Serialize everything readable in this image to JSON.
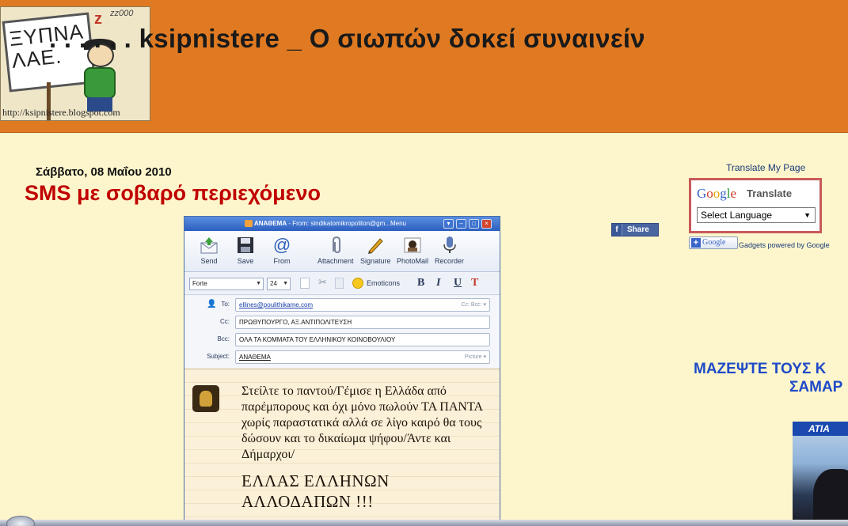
{
  "header": {
    "title": ". . . . . . ksipnistere _ Ο σιωπών δοκεί συναινείν",
    "logo": {
      "sign_text_line1": "ΞΥΠΝΑ",
      "sign_text_line2": "ΛΑΕ.",
      "z_mark": "z",
      "zz_mark": "zz000",
      "url": "http://ksipnistere.blogspot.com"
    }
  },
  "post": {
    "date": "Σάββατο, 08 Μαΐου 2010",
    "title": "SMS με σοβαρό περιεχόμενο",
    "email_window": {
      "titlebar_prefix": "ΑΝΑΘΕΜΑ",
      "titlebar_from": " - From: sindikatomikropoliton@gm...",
      "titlebar_menu": "Menu",
      "toolbar": [
        {
          "label": "Send",
          "icon": "send-envelope-icon"
        },
        {
          "label": "Save",
          "icon": "floppy-disk-icon"
        },
        {
          "label": "From",
          "icon": "at-sign-icon"
        },
        {
          "label": "Attachment",
          "icon": "paperclip-icon"
        },
        {
          "label": "Signature",
          "icon": "pen-icon"
        },
        {
          "label": "PhotoMail",
          "icon": "photo-icon"
        },
        {
          "label": "Recorder",
          "icon": "microphone-icon"
        }
      ],
      "format": {
        "font": "Forte",
        "size": "24",
        "emoticons_label": "Emoticons",
        "bold": "B",
        "italic": "I",
        "underline": "U",
        "text_color": "T"
      },
      "fields": {
        "to_label": "To:",
        "to_value": "ellines@poulithikame.com",
        "to_hint": "Cc: Bcc: ▾",
        "cc_label": "Cc:",
        "cc_value": "ΠΡΩΘΥΠΟΥΡΓΟ, ΑΞ.ΑΝΤΙΠΟΛΙΤΕΥΣΗ",
        "bcc_label": "Bcc:",
        "bcc_value": "ΟΛΑ ΤΑ ΚΟΜΜΑΤΑ ΤΟΥ ΕΛΛΗΝΙΚΟΥ ΚΟΙΝΟΒΟΥΛΙΟΥ",
        "subject_label": "Subject:",
        "subject_value": "ΑΝΑΘΕΜΑ",
        "subject_hint": "Picture ▾"
      },
      "body": {
        "text": "Στείλτε το παντού/Γέμισε η Ελλάδα από παρέμπορους και όχι μόνο πωλούν ΤΑ ΠΑΝΤΑ χωρίς παραστατικά αλλά σε λίγο καιρό θα τους δώσουν και το δικαίωμα ψήφου/Άντε και Δήμαρχοι/",
        "big_line1": "ΕΛΛΑΣ ΕΛΛΗΝΩΝ",
        "big_line2": "ΑΛΛΟΔΑΠΩΝ !!!"
      }
    },
    "share_label": "Share",
    "share_icon_glyph": "f"
  },
  "sidebar": {
    "translate_heading": "Translate My Page",
    "translate_logo": [
      "G",
      "o",
      "o",
      "g",
      "l",
      "e"
    ],
    "translate_label": "Translate",
    "select_language": "Select Language",
    "gadget_badge": "Google",
    "gadgets_powered": "Gadgets powered by Google",
    "headline_line1": "ΜΑΖΕΨΤΕ ΤΟΥΣ Κ",
    "headline_line2": "ΣΑΜΑΡ",
    "photo_banner": "ΑΤΙΑ"
  },
  "colors": {
    "header_bg": "#e07a22",
    "page_bg": "#fdf6cc",
    "post_title": "#c00000",
    "sidebar_headline": "#1e4ac8"
  }
}
